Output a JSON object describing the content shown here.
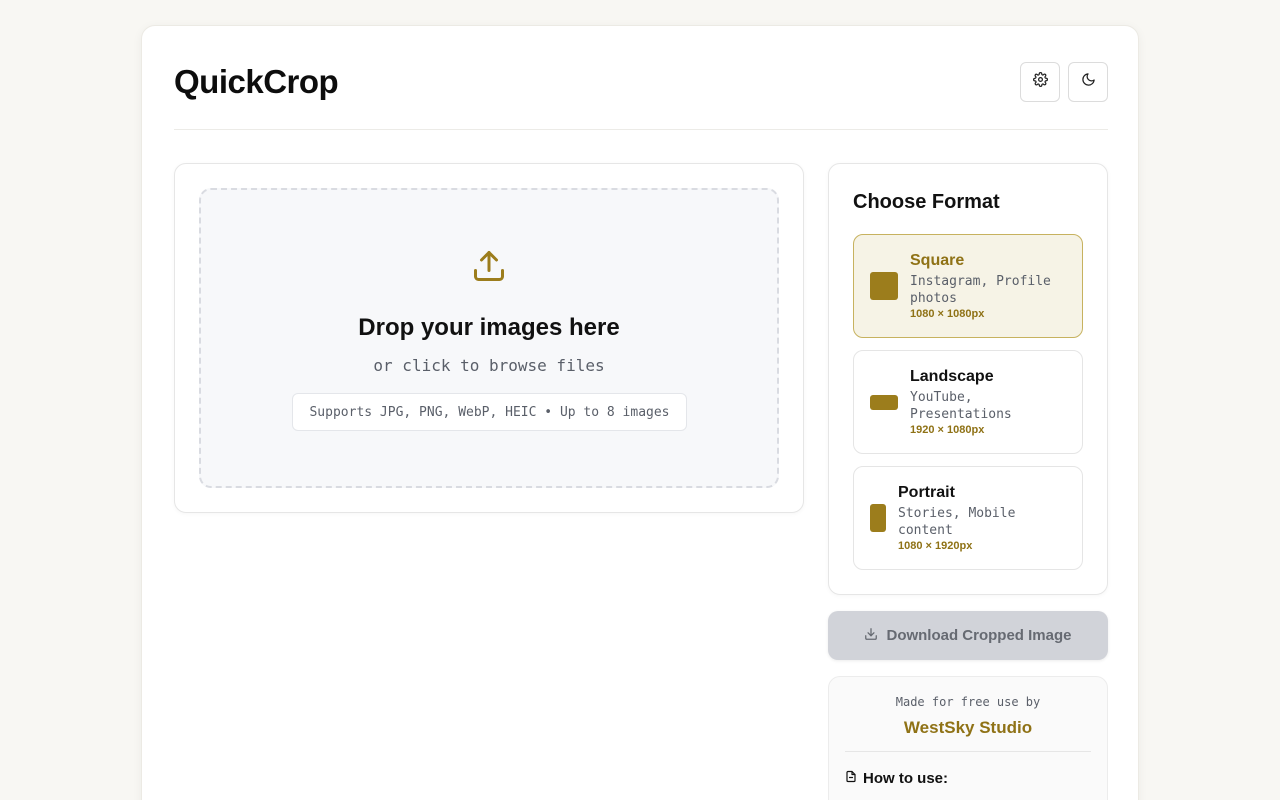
{
  "app": {
    "title": "QuickCrop"
  },
  "header": {
    "settings_icon": "gear-icon",
    "theme_icon": "moon-icon"
  },
  "upload": {
    "icon": "upload-icon",
    "title": "Drop your images here",
    "subtitle": "or click to browse files",
    "supported": "Supports JPG, PNG, WebP, HEIC • Up to 8 images"
  },
  "formats": {
    "heading": "Choose Format",
    "selected": "Square",
    "options": [
      {
        "name": "Square",
        "description": "Instagram, Profile photos",
        "size": "1080 × 1080px"
      },
      {
        "name": "Landscape",
        "description": "YouTube, Presentations",
        "size": "1920 × 1080px"
      },
      {
        "name": "Portrait",
        "description": "Stories, Mobile content",
        "size": "1080 × 1920px"
      }
    ]
  },
  "download": {
    "label": "Download Cropped Image",
    "icon": "download-icon",
    "enabled": false
  },
  "credit": {
    "line": "Made for free use by",
    "studio": "WestSky Studio",
    "how_to": "How to use:",
    "how_to_icon": "document-icon"
  },
  "colors": {
    "accent": "#9c7d1c",
    "accent_text": "#8f7216",
    "selected_bg": "#f6f3e6",
    "page_bg": "#f8f7f3",
    "disabled_button": "#d1d3d9"
  }
}
